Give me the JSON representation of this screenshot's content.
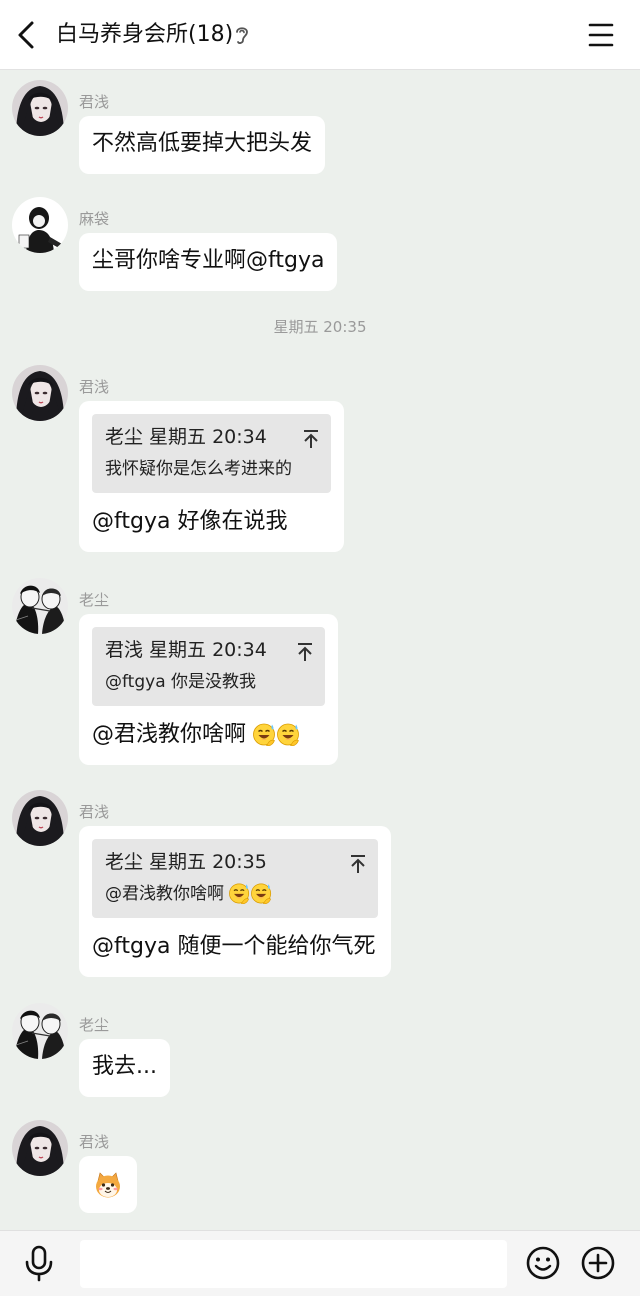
{
  "header": {
    "title": "白马养身会所(18)",
    "back_icon": "chevron-left-icon",
    "mode_icon": "ear-icon",
    "menu_icon": "hamburger-menu-icon"
  },
  "timestamps": {
    "t1": "星期五 20:35"
  },
  "messages": [
    {
      "sender": "君浅",
      "text": "不然高低要掉大把头发"
    },
    {
      "sender": "麻袋",
      "text": "尘哥你啥专业啊@ftgya"
    },
    {
      "sender": "君浅",
      "quote_header": "老尘 星期五 20:34",
      "quote_body": "我怀疑你是怎么考进来的",
      "text": "@ftgya 好像在说我"
    },
    {
      "sender": "老尘",
      "quote_header": "君浅 星期五 20:34",
      "quote_body": "@ftgya 你是没教我",
      "text": "@君浅教你啥啊"
    },
    {
      "sender": "君浅",
      "quote_header": "老尘 星期五 20:35",
      "quote_body": "@君浅教你啥啊",
      "text": "@ftgya 随便一个能给你气死"
    },
    {
      "sender": "老尘",
      "text": "我去..."
    },
    {
      "sender": "君浅",
      "sticker": "shiba-dog-emoji"
    }
  ],
  "input_bar": {
    "placeholder": "",
    "voice_icon": "microphone-icon",
    "emoji_icon": "smiley-icon",
    "more_icon": "plus-circle-icon"
  },
  "colors": {
    "chat_background": "#ecf0ec",
    "bubble": "#ffffff",
    "quote_background": "#e6e6e6",
    "meta_text": "#9a9a9a"
  }
}
